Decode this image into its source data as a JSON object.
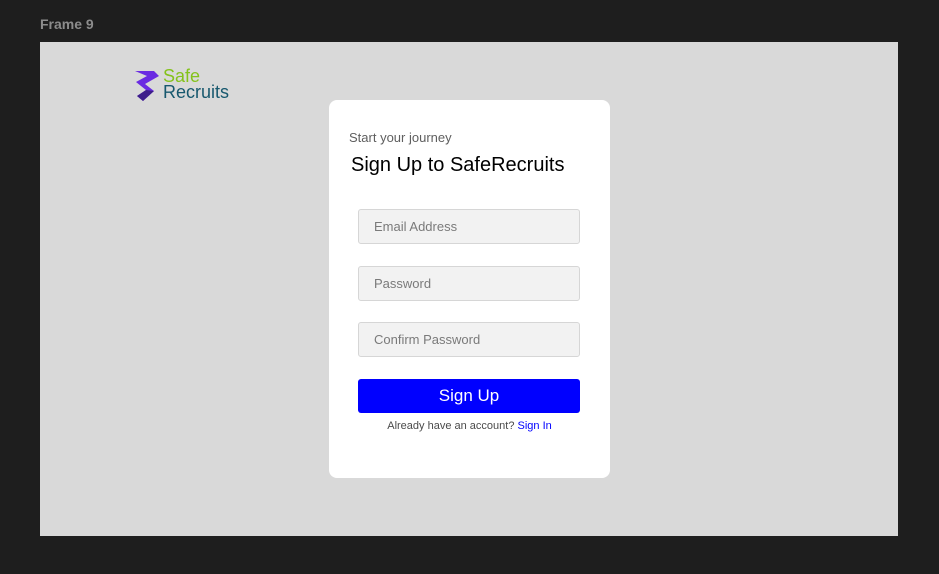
{
  "frame": {
    "label": "Frame 9"
  },
  "logo": {
    "line1": "Safe",
    "line2": "Recruits",
    "icon": "safe-recruits-logo-icon"
  },
  "form": {
    "subtitle": "Start your journey",
    "title": "Sign Up to SafeRecruits",
    "email_placeholder": "Email Address",
    "password_placeholder": "Password",
    "confirm_placeholder": "Confirm Password",
    "submit_label": "Sign Up",
    "account_prompt": "Already have an account?",
    "signin_label": "Sign In"
  },
  "colors": {
    "primary_button": "#0000ff",
    "link": "#0000ff",
    "logo_green": "#84c21b",
    "logo_teal": "#17586e",
    "logo_purple": "#6a2be2",
    "canvas": "#d9d9d9",
    "background": "#1e1e1e"
  }
}
